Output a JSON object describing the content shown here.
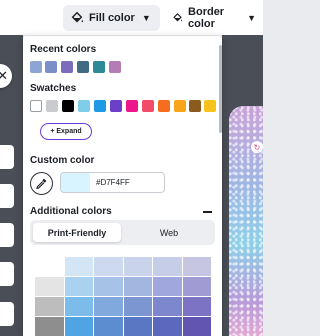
{
  "toolbar": {
    "fill_label": "Fill color",
    "border_label": "Border color"
  },
  "panel": {
    "recent_title": "Recent colors",
    "recent_colors": [
      "#8EA5D3",
      "#7C8EC8",
      "#7A6DBC",
      "#3F6B83",
      "#2E8A97",
      "#B37CB5"
    ],
    "swatches_title": "Swatches",
    "swatches": [
      "#FFFFFF",
      "#C9CBCE",
      "#000000",
      "#7FCDE8",
      "#1E9BE4",
      "#6B3FC6",
      "#EB178B",
      "#F24C6A",
      "#F56E1F",
      "#F9A51B",
      "#8A5A1E",
      "#F6C21E"
    ],
    "expand_label": "+ Expand",
    "custom_title": "Custom color",
    "custom_hex": "#D7F4FF",
    "additional_title": "Additional colors",
    "tabs": [
      "Print-Friendly",
      "Web"
    ],
    "grid_colors": [
      "#FFFFFF",
      "#D4E6F5",
      "#CDD9EE",
      "#C9D3EC",
      "#C5CDE7",
      "#C6C6E2",
      "#E4E4E4",
      "#A8D2F0",
      "#A6C2E6",
      "#A3B6E0",
      "#9FA7DC",
      "#A09BD3",
      "#BDBDBD",
      "#7CBCEB",
      "#82A9DD",
      "#7C96D2",
      "#7C87CE",
      "#7D73C4",
      "#8E8E8E",
      "#4FA4E3",
      "#5B8DD0",
      "#5A77C3",
      "#5A68BE",
      "#6254B1"
    ]
  },
  "colors": {
    "accent": "#6A3BD6",
    "panel_bg": "#FFFFFF",
    "canvas_dark": "#4A4F57"
  }
}
